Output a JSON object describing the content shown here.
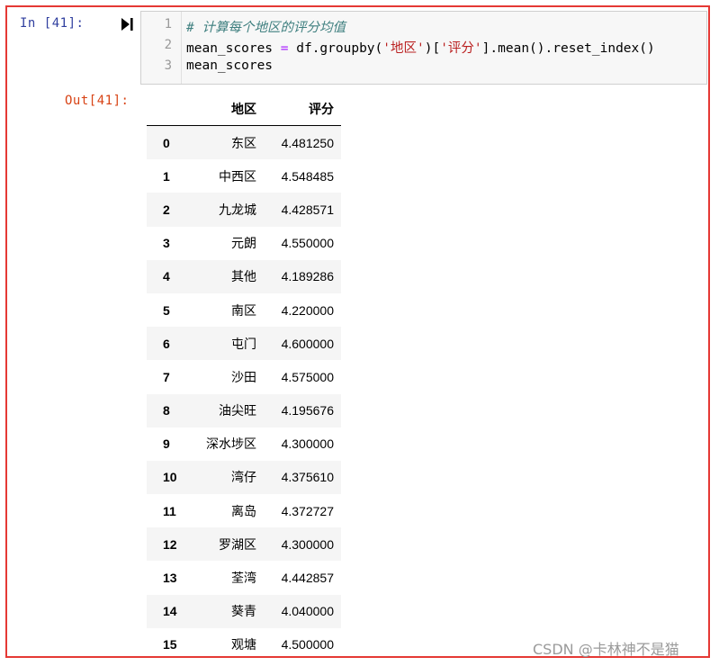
{
  "cell": {
    "in_prompt": "In  [41]:",
    "out_prompt": "Out[41]:",
    "run_icon": "run-step-icon",
    "code_lines": [
      {
        "num": "1",
        "parts": [
          {
            "cls": "cm-comment",
            "text": "# 计算每个地区的评分均值"
          }
        ]
      },
      {
        "num": "2",
        "parts": [
          {
            "cls": "",
            "text": "mean_scores "
          },
          {
            "cls": "cm-op",
            "text": "="
          },
          {
            "cls": "",
            "text": " df.groupby("
          },
          {
            "cls": "cm-str",
            "text": "'地区'"
          },
          {
            "cls": "",
            "text": ")["
          },
          {
            "cls": "cm-str",
            "text": "'评分'"
          },
          {
            "cls": "",
            "text": "].mean().reset_index()"
          }
        ]
      },
      {
        "num": "3",
        "parts": [
          {
            "cls": "",
            "text": "mean_scores"
          }
        ]
      }
    ]
  },
  "table": {
    "columns": [
      "",
      "地区",
      "评分"
    ],
    "rows": [
      [
        "0",
        "东区",
        "4.481250"
      ],
      [
        "1",
        "中西区",
        "4.548485"
      ],
      [
        "2",
        "九龙城",
        "4.428571"
      ],
      [
        "3",
        "元朗",
        "4.550000"
      ],
      [
        "4",
        "其他",
        "4.189286"
      ],
      [
        "5",
        "南区",
        "4.220000"
      ],
      [
        "6",
        "屯门",
        "4.600000"
      ],
      [
        "7",
        "沙田",
        "4.575000"
      ],
      [
        "8",
        "油尖旺",
        "4.195676"
      ],
      [
        "9",
        "深水埗区",
        "4.300000"
      ],
      [
        "10",
        "湾仔",
        "4.375610"
      ],
      [
        "11",
        "离岛",
        "4.372727"
      ],
      [
        "12",
        "罗湖区",
        "4.300000"
      ],
      [
        "13",
        "荃湾",
        "4.442857"
      ],
      [
        "14",
        "葵青",
        "4.040000"
      ],
      [
        "15",
        "观塘",
        "4.500000"
      ]
    ]
  },
  "watermark": "CSDN @卡林神不是猫",
  "colors": {
    "frame": "#e53935",
    "in_prompt": "#303f9f",
    "out_prompt": "#d84315"
  }
}
